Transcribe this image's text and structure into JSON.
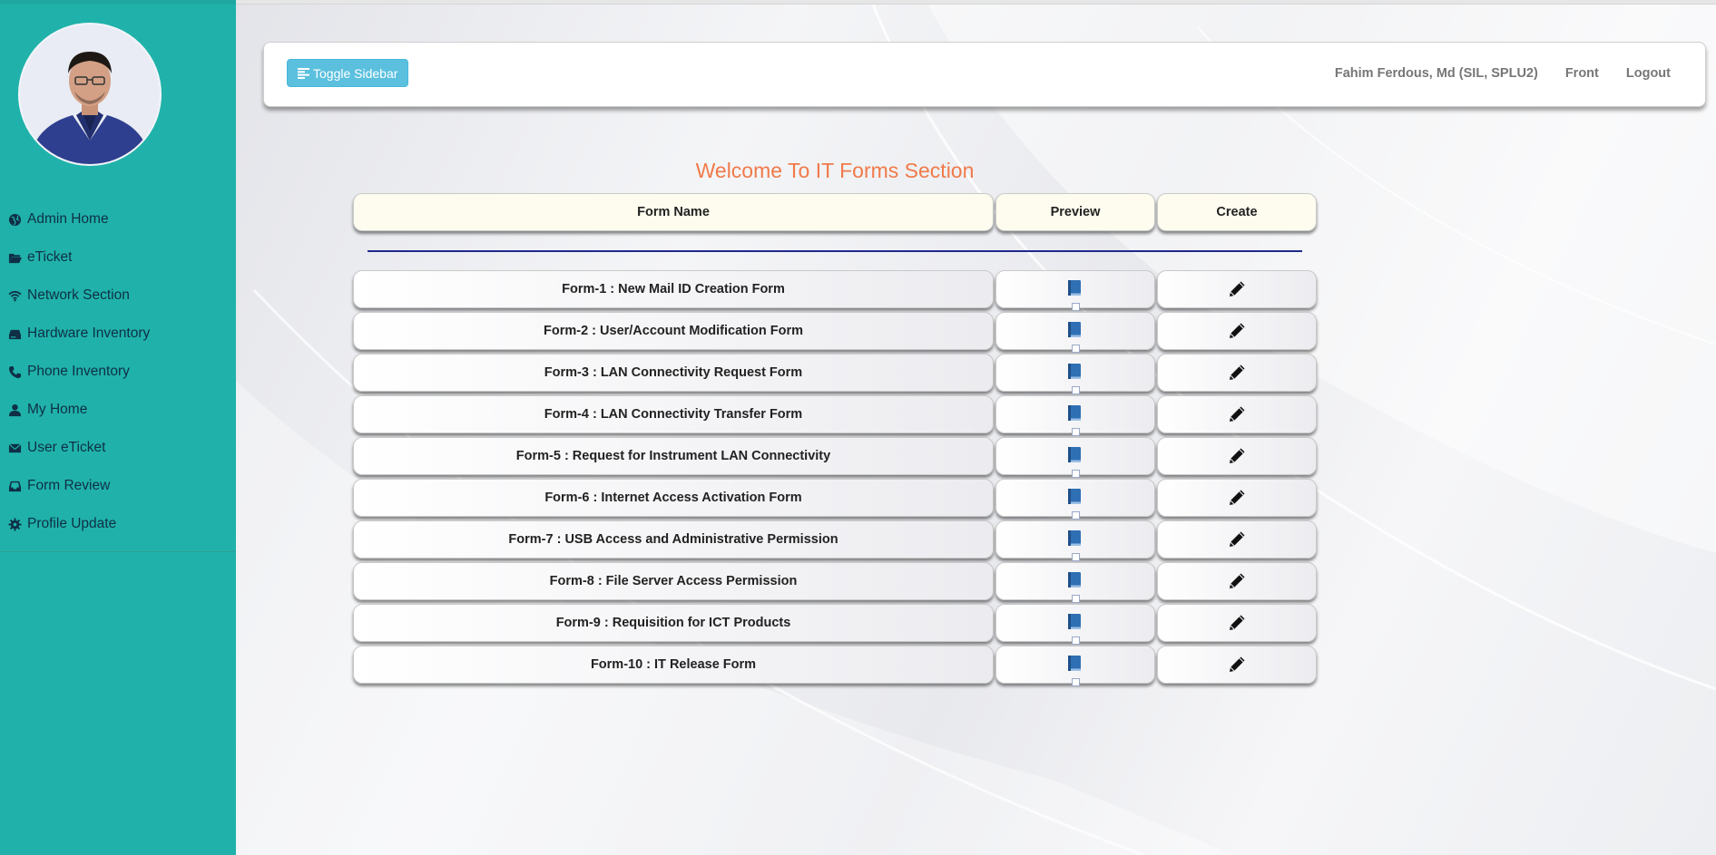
{
  "sidebar": {
    "avatar_alt": "",
    "items": [
      {
        "label": "Admin Home",
        "icon": "globe-icon"
      },
      {
        "label": "eTicket",
        "icon": "folder-open-icon"
      },
      {
        "label": "Network Section",
        "icon": "wifi-icon"
      },
      {
        "label": "Hardware Inventory",
        "icon": "hdd-icon"
      },
      {
        "label": "Phone Inventory",
        "icon": "phone-icon"
      },
      {
        "label": "My Home",
        "icon": "user-icon"
      },
      {
        "label": "User eTicket",
        "icon": "envelope-icon"
      },
      {
        "label": "Form Review",
        "icon": "inbox-icon"
      },
      {
        "label": "Profile Update",
        "icon": "gear-icon"
      }
    ]
  },
  "header": {
    "toggle_label": "Toggle Sidebar",
    "user_name": "Fahim Ferdous, Md (SIL, SPLU2)",
    "front_link": "Front",
    "logout_link": "Logout"
  },
  "main": {
    "title": "Welcome To IT Forms Section",
    "table": {
      "headers": {
        "name": "Form Name",
        "preview": "Preview",
        "create": "Create"
      },
      "rows": [
        {
          "name": "Form-1 : New Mail ID Creation Form"
        },
        {
          "name": "Form-2 : User/Account Modification Form"
        },
        {
          "name": "Form-3 : LAN Connectivity Request Form"
        },
        {
          "name": "Form-4 : LAN Connectivity Transfer Form"
        },
        {
          "name": "Form-5 : Request for Instrument LAN Connectivity"
        },
        {
          "name": "Form-6 : Internet Access Activation Form"
        },
        {
          "name": "Form-7 : USB Access and Administrative Permission"
        },
        {
          "name": "Form-8 : File Server Access Permission"
        },
        {
          "name": "Form-9 : Requisition for ICT Products"
        },
        {
          "name": "Form-10 : IT Release Form"
        }
      ]
    }
  },
  "colors": {
    "sidebar_bg": "#20b2aa",
    "toggle_bg": "#5bc0de",
    "title_color": "#f07a4a",
    "header_cell_bg": "#fdfcee",
    "divider_blue": "#1f2a8c",
    "icon_blue": "#2f6fb4"
  }
}
